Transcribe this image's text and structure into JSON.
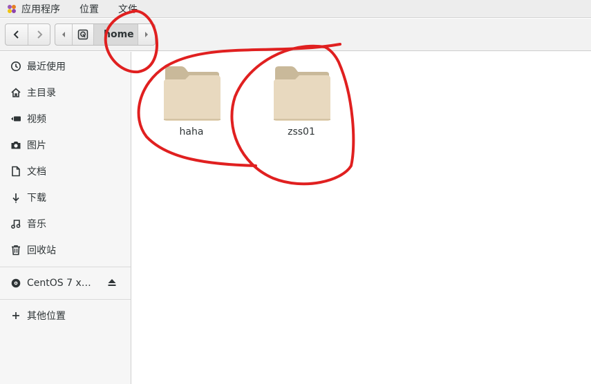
{
  "menubar": {
    "items": [
      "应用程序",
      "位置",
      "文件"
    ]
  },
  "pathbar": {
    "current": "home"
  },
  "sidebar": {
    "places": [
      {
        "label": "最近使用",
        "icon": "clock-icon"
      },
      {
        "label": "主目录",
        "icon": "home-icon"
      },
      {
        "label": "视频",
        "icon": "video-icon"
      },
      {
        "label": "图片",
        "icon": "camera-icon"
      },
      {
        "label": "文档",
        "icon": "document-icon"
      },
      {
        "label": "下载",
        "icon": "download-icon"
      },
      {
        "label": "音乐",
        "icon": "music-icon"
      },
      {
        "label": "回收站",
        "icon": "trash-icon"
      }
    ],
    "device": {
      "label": "CentOS 7 x…",
      "icon": "disc-icon"
    },
    "other": {
      "label": "其他位置",
      "icon": "plus-icon"
    }
  },
  "files": [
    {
      "name": "haha",
      "icon": "folder-icon"
    },
    {
      "name": "zss01",
      "icon": "folder-icon"
    }
  ],
  "colors": {
    "annotation": "#e02020",
    "folder_back": "#c9b99a",
    "folder_front": "#e8d9bf"
  }
}
